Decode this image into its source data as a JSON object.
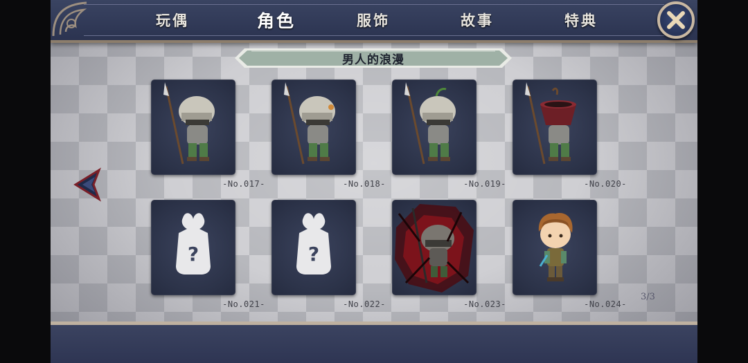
{
  "tabs": [
    {
      "label": "玩偶",
      "active": false
    },
    {
      "label": "角色",
      "active": true
    },
    {
      "label": "服饰",
      "active": false
    },
    {
      "label": "故事",
      "active": false
    },
    {
      "label": "特典",
      "active": false
    }
  ],
  "banner": {
    "title": "男人的浪漫"
  },
  "cards": [
    {
      "label": "-No.017-",
      "state": "unlocked",
      "portrait": "helmet-spear-soldier-icon"
    },
    {
      "label": "-No.018-",
      "state": "unlocked",
      "portrait": "helmet-spear-soldier-icon"
    },
    {
      "label": "-No.019-",
      "state": "unlocked",
      "portrait": "helmet-spear-soldier-icon"
    },
    {
      "label": "-No.020-",
      "state": "unlocked",
      "portrait": "pot-helmet-soldier-icon"
    },
    {
      "label": "-No.021-",
      "state": "locked",
      "portrait": "mystery-silhouette-icon"
    },
    {
      "label": "-No.022-",
      "state": "locked",
      "portrait": "mystery-silhouette-icon"
    },
    {
      "label": "-No.023-",
      "state": "corrupted",
      "portrait": "dark-aura-soldier-icon"
    },
    {
      "label": "-No.024-",
      "state": "unlocked",
      "portrait": "brown-hair-boy-icon"
    }
  ],
  "pagination": {
    "text": "3/3"
  },
  "icons": {
    "close": "close-icon",
    "prev": "left-arrow-icon"
  },
  "colors": {
    "bar": "#2b3350",
    "accent": "#c9b8a2",
    "banner": "#9fb1a6",
    "card": "#2c3349"
  }
}
